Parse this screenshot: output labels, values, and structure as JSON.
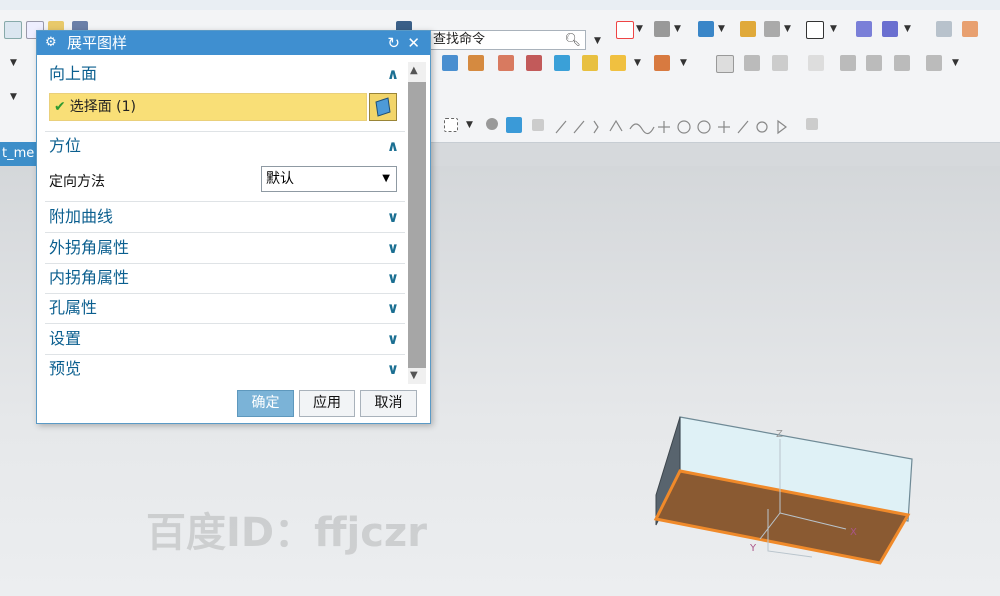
{
  "toolbar": {
    "search_value": "查找命令"
  },
  "model_tab": {
    "label": "t_me"
  },
  "dialog": {
    "title": "展平图样",
    "sections": {
      "top_face": {
        "label": "向上面",
        "selection_text": "选择面 (1)"
      },
      "orientation": {
        "label": "方位",
        "method_label": "定向方法",
        "method_value": "默认"
      },
      "additional_curves": {
        "label": "附加曲线"
      },
      "outer_corner": {
        "label": "外拐角属性"
      },
      "inner_corner": {
        "label": "内拐角属性"
      },
      "hole": {
        "label": "孔属性"
      },
      "settings": {
        "label": "设置"
      },
      "preview": {
        "label": "预览"
      }
    },
    "buttons": {
      "ok": "确定",
      "apply": "应用",
      "cancel": "取消"
    }
  },
  "watermark": {
    "text": "百度ID：ffjczr"
  },
  "axes": {
    "x": "X",
    "y": "Y",
    "z": "Z"
  },
  "colors": {
    "title_bar": "#3f8fd0",
    "selection": "#f9df77",
    "section_header": "#0b5f8f",
    "face": "#8a5a32",
    "edge": "#f08a2a"
  }
}
